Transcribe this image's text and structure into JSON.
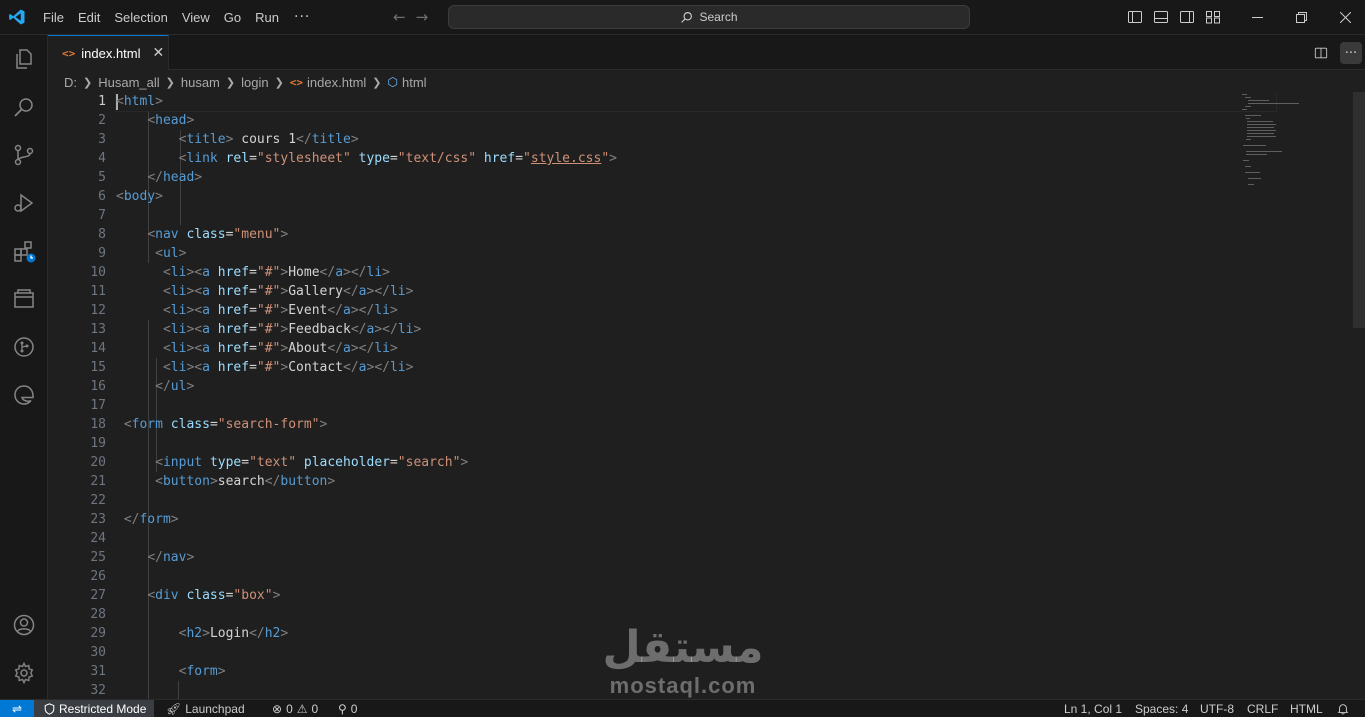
{
  "menu": {
    "items": [
      "File",
      "Edit",
      "Selection",
      "View",
      "Go",
      "Run"
    ],
    "more": "···"
  },
  "search": {
    "label": "Search"
  },
  "tab": {
    "label": "index.html",
    "close": "✕"
  },
  "breadcrumb": [
    "D:",
    "Husam_all",
    "husam",
    "login",
    "index.html",
    "html"
  ],
  "editor": {
    "active_line": 1,
    "lines": [
      {
        "n": "1"
      },
      {
        "n": "2"
      },
      {
        "n": "3"
      },
      {
        "n": "4"
      },
      {
        "n": "5"
      },
      {
        "n": "6"
      },
      {
        "n": "7"
      },
      {
        "n": "8"
      },
      {
        "n": "9"
      },
      {
        "n": "10"
      },
      {
        "n": "11"
      },
      {
        "n": "12"
      },
      {
        "n": "13"
      },
      {
        "n": "14"
      },
      {
        "n": "15"
      },
      {
        "n": "16"
      },
      {
        "n": "17"
      },
      {
        "n": "18"
      },
      {
        "n": "19"
      },
      {
        "n": "20"
      },
      {
        "n": "21"
      },
      {
        "n": "22"
      },
      {
        "n": "23"
      },
      {
        "n": "24"
      },
      {
        "n": "25"
      },
      {
        "n": "26"
      },
      {
        "n": "27"
      },
      {
        "n": "28"
      },
      {
        "n": "29"
      },
      {
        "n": "30"
      },
      {
        "n": "31"
      },
      {
        "n": "32"
      }
    ],
    "code": {
      "l1_tag": "html",
      "l2_tag": "head",
      "l3_tag": "title",
      "l3_text": " cours 1",
      "l3_close": "title",
      "l4_tag": "link",
      "l4_attr1": "rel",
      "l4_val1": "\"stylesheet\"",
      "l4_attr2": "type",
      "l4_val2": "\"text/css\"",
      "l4_attr3": "href",
      "l4_val3": "style.css",
      "l5_close": "head",
      "l6_tag": "body",
      "l8_tag": "nav",
      "l8_attr": "class",
      "l8_val": "\"menu\"",
      "l9_tag": "ul",
      "li_tag": "li",
      "a_tag": "a",
      "href_attr": "href",
      "href_val": "\"#\"",
      "nav_items": [
        "Home",
        "Gallery",
        "Event",
        "Feedback",
        "About",
        "Contact"
      ],
      "l16_close": "ul",
      "l18_tag": "form",
      "l18_attr": "class",
      "l18_val": "\"search-form\"",
      "l20_tag": "input",
      "l20_attr1": "type",
      "l20_val1": "\"text\"",
      "l20_attr2": "placeholder",
      "l20_val2": "\"search\"",
      "l21_tag": "button",
      "l21_text": "search",
      "l21_close": "button",
      "l23_close": "form",
      "l25_close": "nav",
      "l27_tag": "div",
      "l27_attr": "class",
      "l27_val": "\"box\"",
      "l29_tag": "h2",
      "l29_text": "Login",
      "l29_close": "h2",
      "l31_tag": "form"
    }
  },
  "watermark": {
    "arabic": "مستقل",
    "latin": "mostaql.com"
  },
  "statusbar": {
    "restricted": "Restricted Mode",
    "launchpad": "Launchpad",
    "errors": "0",
    "warnings": "0",
    "ports": "0",
    "position": "Ln 1, Col 1",
    "spaces": "Spaces: 4",
    "encoding": "UTF-8",
    "eol": "CRLF",
    "language": "HTML"
  },
  "colors": {
    "accent": "#0078d4",
    "tag": "#569cd6",
    "attribute": "#9cdcfe",
    "string": "#ce9178",
    "html_icon": "#e37933"
  }
}
